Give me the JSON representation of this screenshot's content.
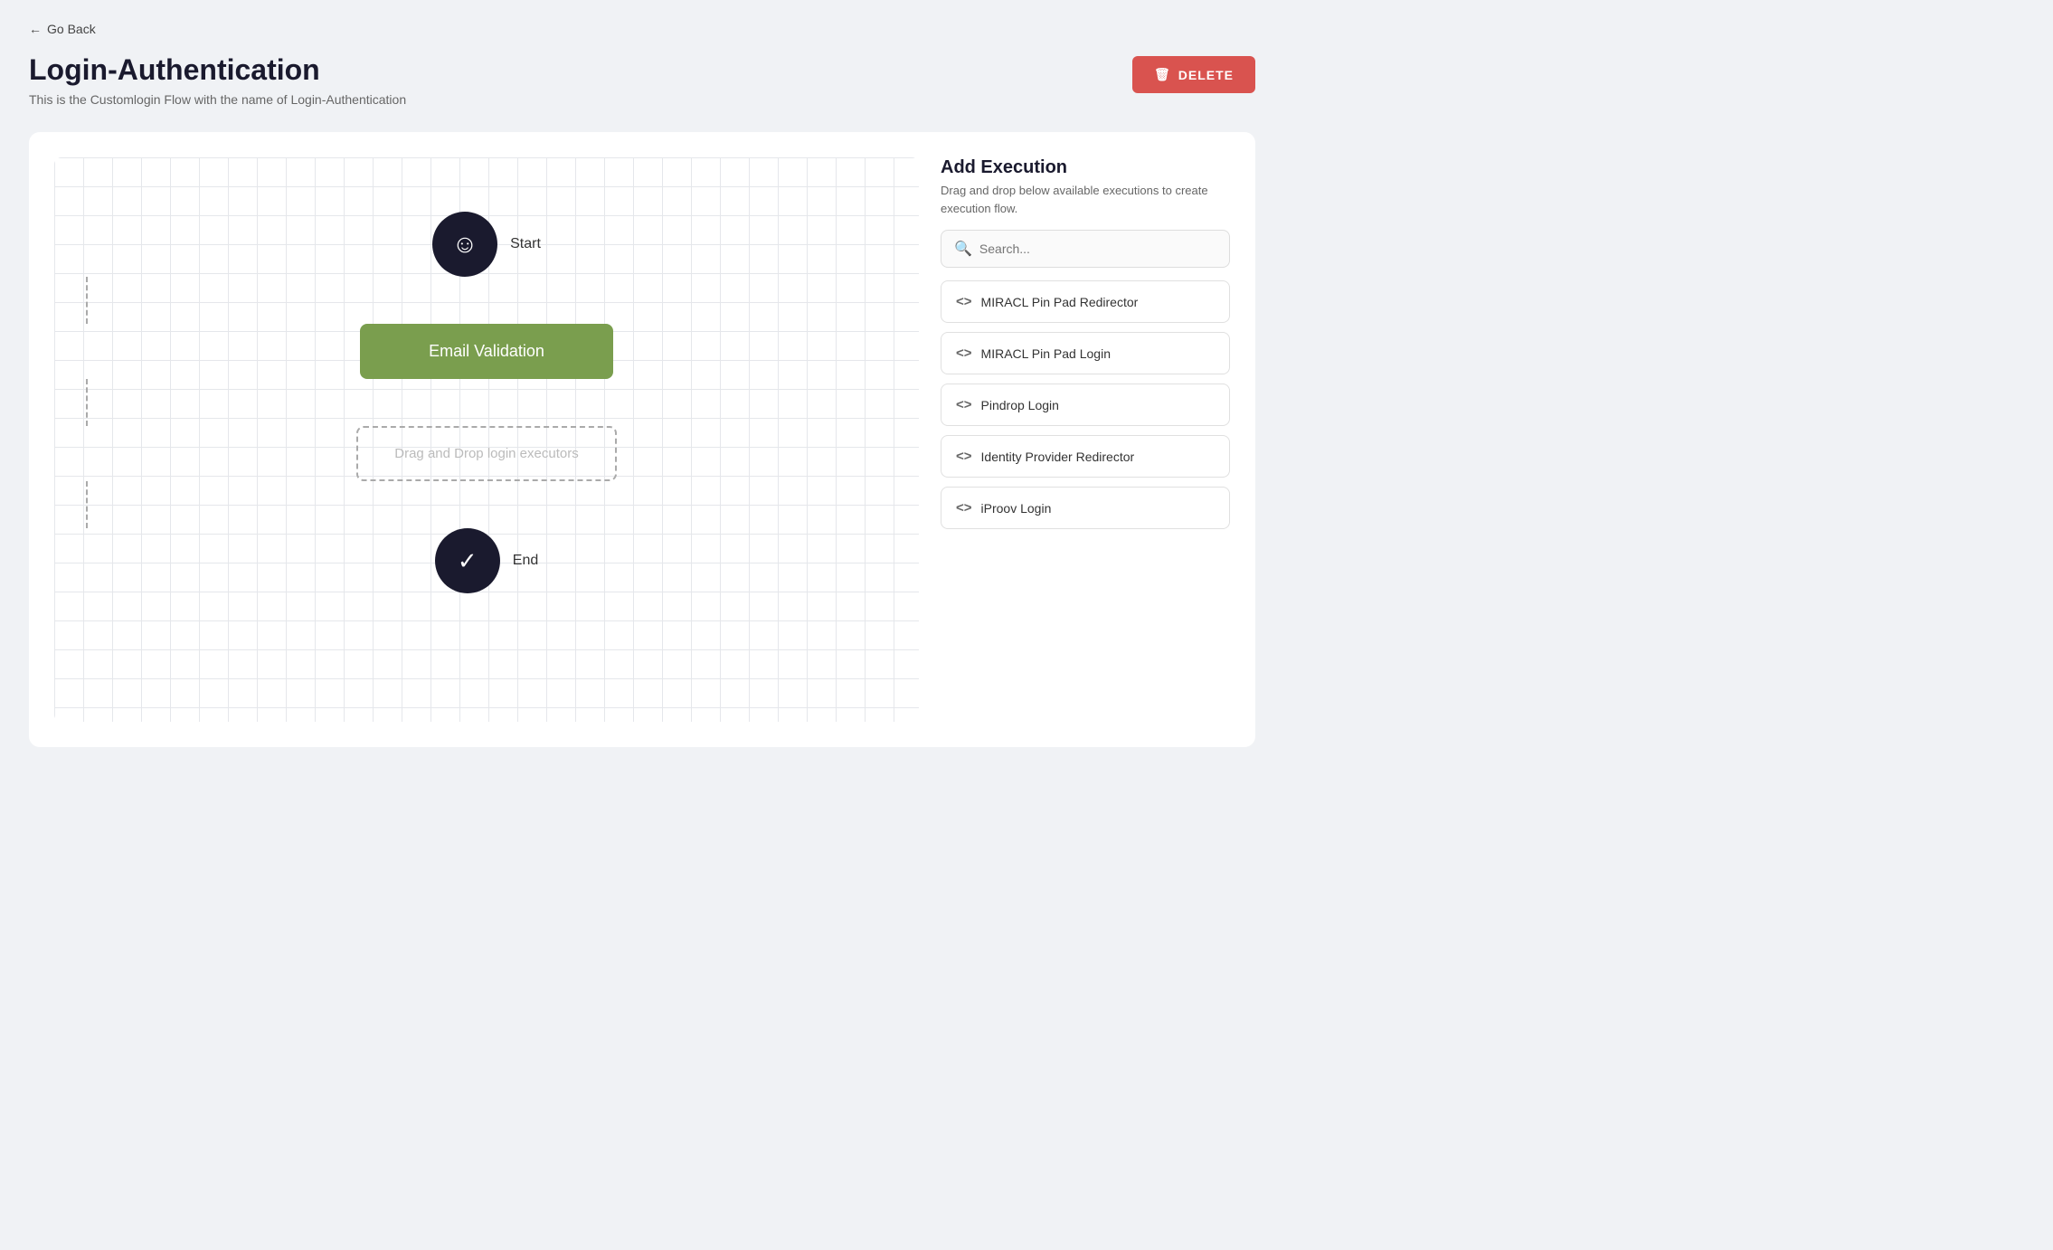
{
  "nav": {
    "go_back_label": "Go Back"
  },
  "header": {
    "title": "Login-Authentication",
    "subtitle": "This is the Customlogin Flow with the name of Login-Authentication",
    "delete_label": "DELETE"
  },
  "flow": {
    "start_label": "Start",
    "email_validation_label": "Email Validation",
    "drag_drop_label": "Drag and Drop login executors",
    "end_label": "End"
  },
  "sidebar": {
    "title": "Add Execution",
    "description": "Drag and drop below available executions to create execution flow.",
    "search_placeholder": "Search...",
    "executors": [
      {
        "id": "miracl-pin-pad-redirector",
        "label": "MIRACL Pin Pad Redirector"
      },
      {
        "id": "miracl-pin-pad-login",
        "label": "MIRACL Pin Pad Login"
      },
      {
        "id": "pindrop-login",
        "label": "Pindrop Login"
      },
      {
        "id": "identity-provider-redirector",
        "label": "Identity Provider Redirector"
      },
      {
        "id": "iproov-login",
        "label": "iProov Login"
      }
    ]
  }
}
